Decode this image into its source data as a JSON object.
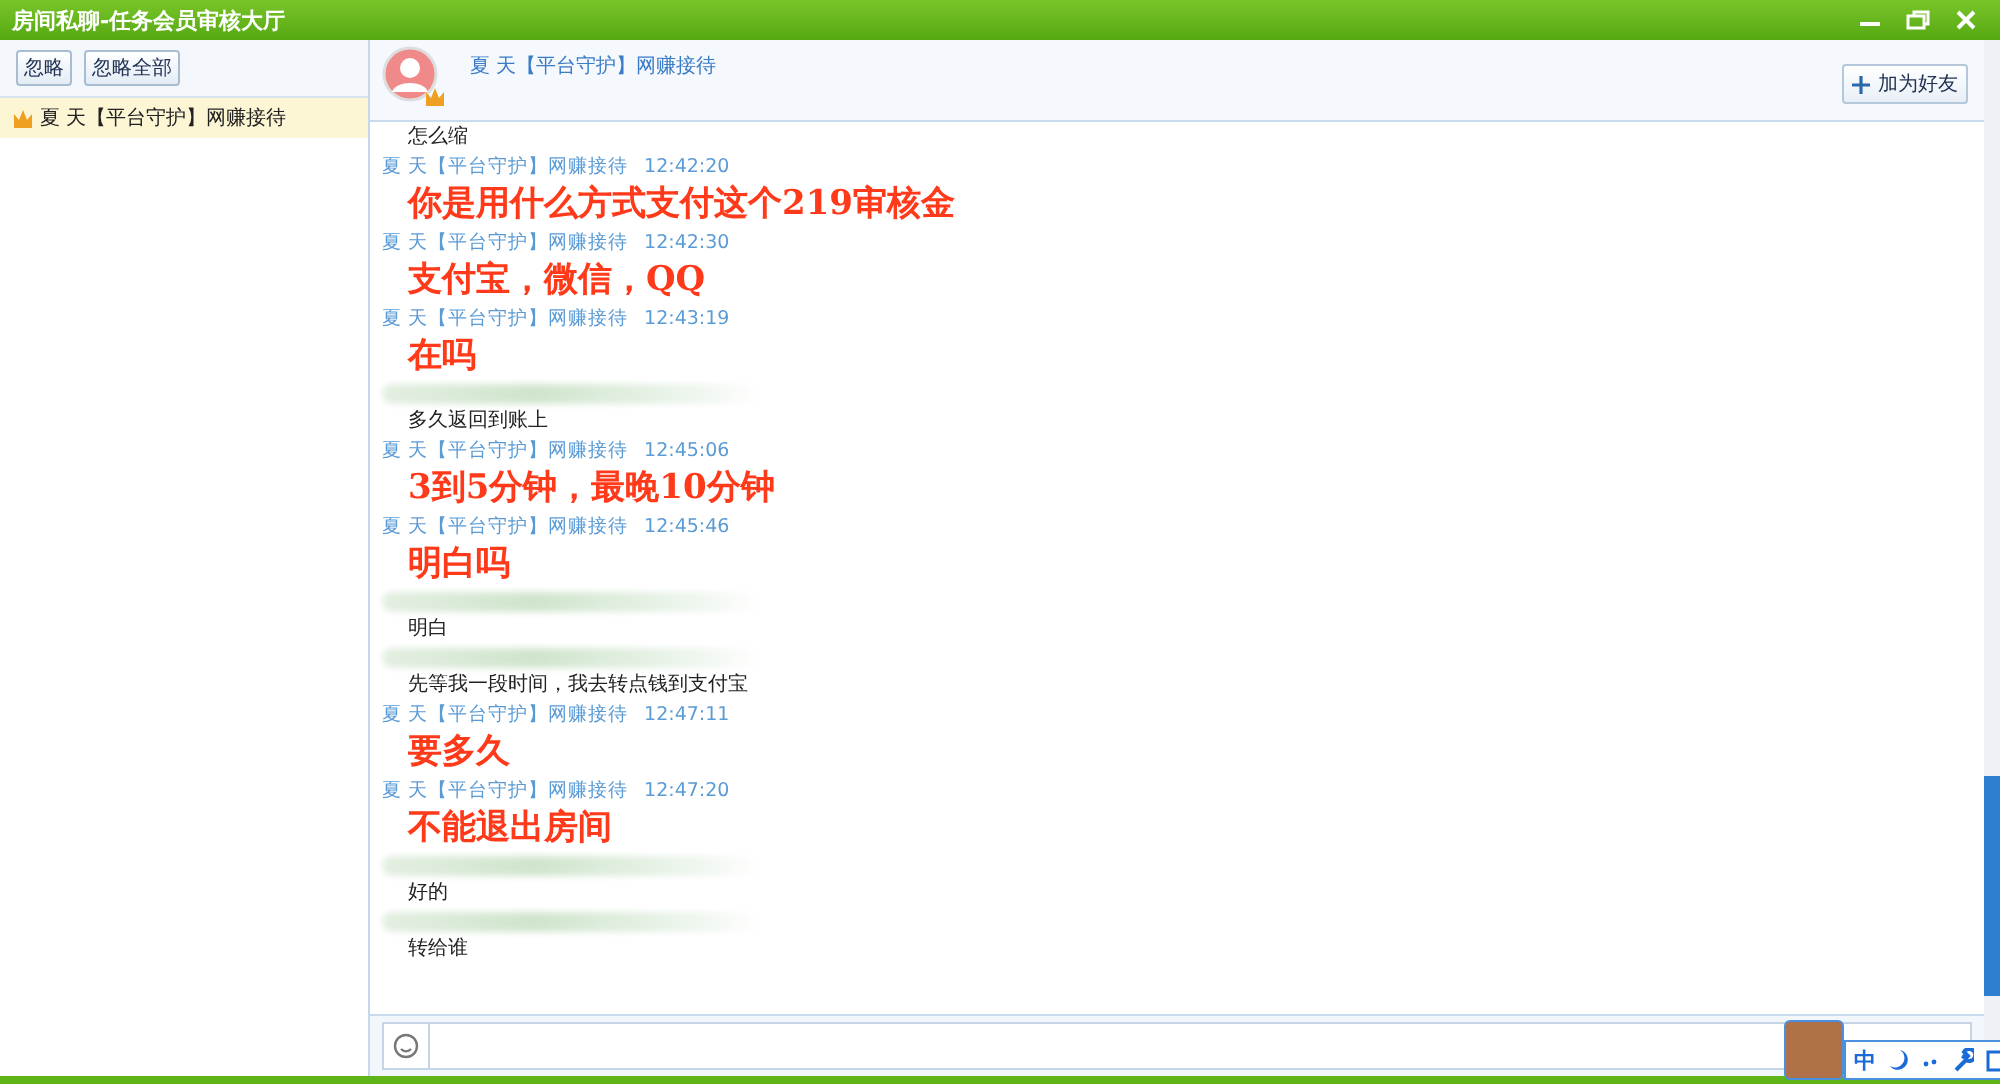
{
  "window": {
    "title": "房间私聊-任务会员审核大厅"
  },
  "sidebar": {
    "buttons": [
      "忽略",
      "忽略全部"
    ],
    "items": [
      {
        "label": "夏 天【平台守护】网赚接待",
        "selected": true
      }
    ]
  },
  "chat": {
    "contact": "夏 天【平台守护】网赚接待",
    "add_friend": "加为好友",
    "messages": [
      {
        "kind": "sent",
        "blurred_sender": false,
        "text": "怎么缩"
      },
      {
        "kind": "received",
        "sender": "夏 天【平台守护】网赚接待",
        "time": "12:42:20",
        "text": "你是用什么方式支付这个219审核金"
      },
      {
        "kind": "received",
        "sender": "夏 天【平台守护】网赚接待",
        "time": "12:42:30",
        "text": "支付宝，微信，QQ"
      },
      {
        "kind": "received",
        "sender": "夏 天【平台守护】网赚接待",
        "time": "12:43:19",
        "text": "在吗"
      },
      {
        "kind": "sent",
        "blurred_sender": true,
        "text": "多久返回到账上"
      },
      {
        "kind": "received",
        "sender": "夏 天【平台守护】网赚接待",
        "time": "12:45:06",
        "text": "3到5分钟，最晚10分钟"
      },
      {
        "kind": "received",
        "sender": "夏 天【平台守护】网赚接待",
        "time": "12:45:46",
        "text": "明白吗"
      },
      {
        "kind": "sent",
        "blurred_sender": true,
        "text": "明白"
      },
      {
        "kind": "sent",
        "blurred_sender": true,
        "text": "先等我一段时间，我去转点钱到支付宝"
      },
      {
        "kind": "received",
        "sender": "夏 天【平台守护】网赚接待",
        "time": "12:47:11",
        "text": "要多久"
      },
      {
        "kind": "received",
        "sender": "夏 天【平台守护】网赚接待",
        "time": "12:47:20",
        "text": "不能退出房间"
      },
      {
        "kind": "sent",
        "blurred_sender": true,
        "text": "好的"
      },
      {
        "kind": "sent",
        "blurred_sender": true,
        "text": "转给谁"
      }
    ]
  },
  "ime_toolbar": {
    "mode": "中"
  }
}
